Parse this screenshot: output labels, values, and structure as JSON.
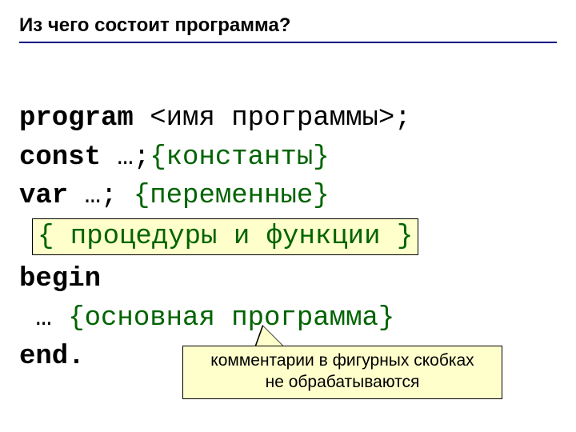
{
  "title": "Из чего состоит программа?",
  "code": {
    "kw_program": "program",
    "program_rest": " <имя программы>;",
    "kw_const": "const",
    "const_rest": " …;",
    "const_comment": "{константы}",
    "kw_var": "var",
    "var_rest": " …; ",
    "var_comment": "{переменные}",
    "proc_box": "{ процедуры и функции }",
    "kw_begin": "begin",
    "main_indent": " … ",
    "main_comment": "{основная программа}",
    "kw_end": "end."
  },
  "callout": {
    "line1": "комментарии в фигурных скобках",
    "line2": "не обрабатываются"
  }
}
